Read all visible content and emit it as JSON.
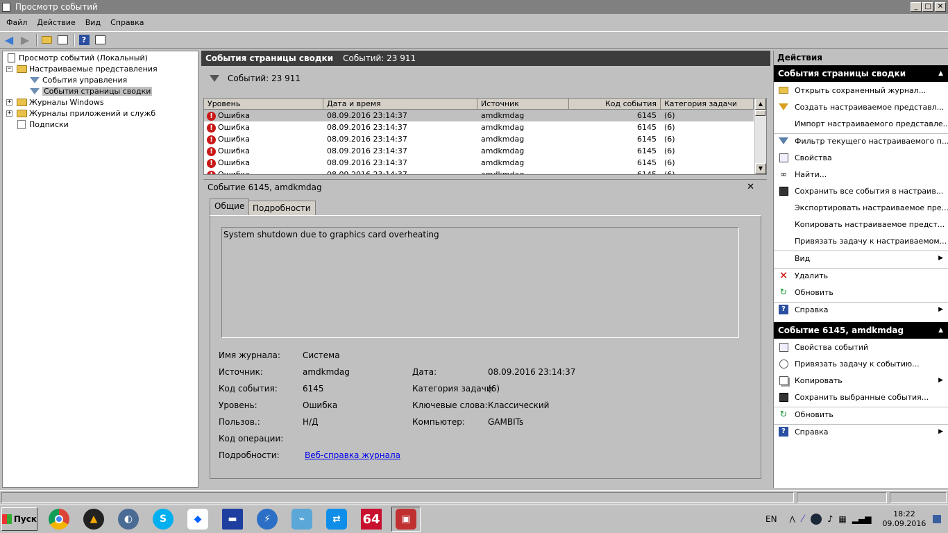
{
  "window": {
    "title": "Просмотр событий",
    "min": "_",
    "max": "□",
    "close": "✕"
  },
  "menu": [
    "Файл",
    "Действие",
    "Вид",
    "Справка"
  ],
  "tree": {
    "root": "Просмотр событий (Локальный)",
    "custom_views": "Настраиваемые представления",
    "admin_events": "События управления",
    "summary_events": "События страницы сводки",
    "windows_logs": "Журналы Windows",
    "app_logs": "Журналы приложений и служб",
    "subscriptions": "Подписки"
  },
  "center": {
    "header_title": "События страницы сводки",
    "header_count": "Событий: 23 911",
    "filter_count": "Событий: 23 911",
    "columns": [
      "Уровень",
      "Дата и время",
      "Источник",
      "Код события",
      "Категория задачи"
    ],
    "rows": [
      {
        "level": "Ошибка",
        "datetime": "08.09.2016 23:14:37",
        "source": "amdkmdag",
        "code": "6145",
        "category": "(6)"
      },
      {
        "level": "Ошибка",
        "datetime": "08.09.2016 23:14:37",
        "source": "amdkmdag",
        "code": "6145",
        "category": "(6)"
      },
      {
        "level": "Ошибка",
        "datetime": "08.09.2016 23:14:37",
        "source": "amdkmdag",
        "code": "6145",
        "category": "(6)"
      },
      {
        "level": "Ошибка",
        "datetime": "08.09.2016 23:14:37",
        "source": "amdkmdag",
        "code": "6145",
        "category": "(6)"
      },
      {
        "level": "Ошибка",
        "datetime": "08.09.2016 23:14:37",
        "source": "amdkmdag",
        "code": "6145",
        "category": "(6)"
      },
      {
        "level": "Ошибка",
        "datetime": "08.09.2016 23:14:37",
        "source": "amdkmdag",
        "code": "6145",
        "category": "(6)"
      }
    ]
  },
  "detail": {
    "title": "Событие 6145, amdkmdag",
    "close": "✕",
    "tab_general": "Общие",
    "tab_details": "Подробности",
    "message": "System shutdown due to graphics card overheating",
    "log_name_label": "Имя журнала:",
    "log_name": "Система",
    "source_label": "Источник:",
    "source": "amdkmdag",
    "date_label": "Дата:",
    "date": "08.09.2016 23:14:37",
    "event_id_label": "Код события:",
    "event_id": "6145",
    "task_cat_label": "Категория задачи:",
    "task_cat": "(6)",
    "level_label": "Уровень:",
    "level": "Ошибка",
    "keywords_label": "Ключевые слова:",
    "keywords": "Классический",
    "user_label": "Пользов.:",
    "user": "Н/Д",
    "computer_label": "Компьютер:",
    "computer": "GAMBITs",
    "opcode_label": "Код операции:",
    "more_label": "Подробности:",
    "more_link": "Веб-справка журнала"
  },
  "actions": {
    "title": "Действия",
    "section1": "События страницы сводки",
    "s1_items": [
      {
        "label": "Открыть сохраненный журнал...",
        "icon": "open-folder-icon"
      },
      {
        "label": "Создать настраиваемое представл...",
        "icon": "create-view-icon"
      },
      {
        "label": "Импорт настраиваемого представле...",
        "icon": "none"
      },
      {
        "label": "Фильтр текущего настраиваемого п...",
        "icon": "filter-icon"
      },
      {
        "label": "Свойства",
        "icon": "properties-icon"
      },
      {
        "label": "Найти...",
        "icon": "binoculars-icon"
      },
      {
        "label": "Сохранить все события в настраив...",
        "icon": "save-icon"
      },
      {
        "label": "Экспортировать настраиваемое пре...",
        "icon": "none"
      },
      {
        "label": "Копировать настраиваемое предст...",
        "icon": "none"
      },
      {
        "label": "Привязать задачу к настраиваемом...",
        "icon": "none"
      },
      {
        "label": "Вид",
        "icon": "none"
      },
      {
        "label": "Удалить",
        "icon": "delete-icon"
      },
      {
        "label": "Обновить",
        "icon": "refresh-icon"
      },
      {
        "label": "Справка",
        "icon": "help-icon"
      }
    ],
    "section2": "Событие 6145, amdkmdag",
    "s2_items": [
      {
        "label": "Свойства событий",
        "icon": "properties-icon"
      },
      {
        "label": "Привязать задачу к событию...",
        "icon": "task-icon"
      },
      {
        "label": "Копировать",
        "icon": "copy-icon"
      },
      {
        "label": "Сохранить выбранные события...",
        "icon": "save-icon"
      },
      {
        "label": "Обновить",
        "icon": "refresh-icon"
      },
      {
        "label": "Справка",
        "icon": "help-icon"
      }
    ]
  },
  "taskbar": {
    "start": "Пуск",
    "lang": "EN",
    "time": "18:22",
    "date": "09.09.2016"
  }
}
